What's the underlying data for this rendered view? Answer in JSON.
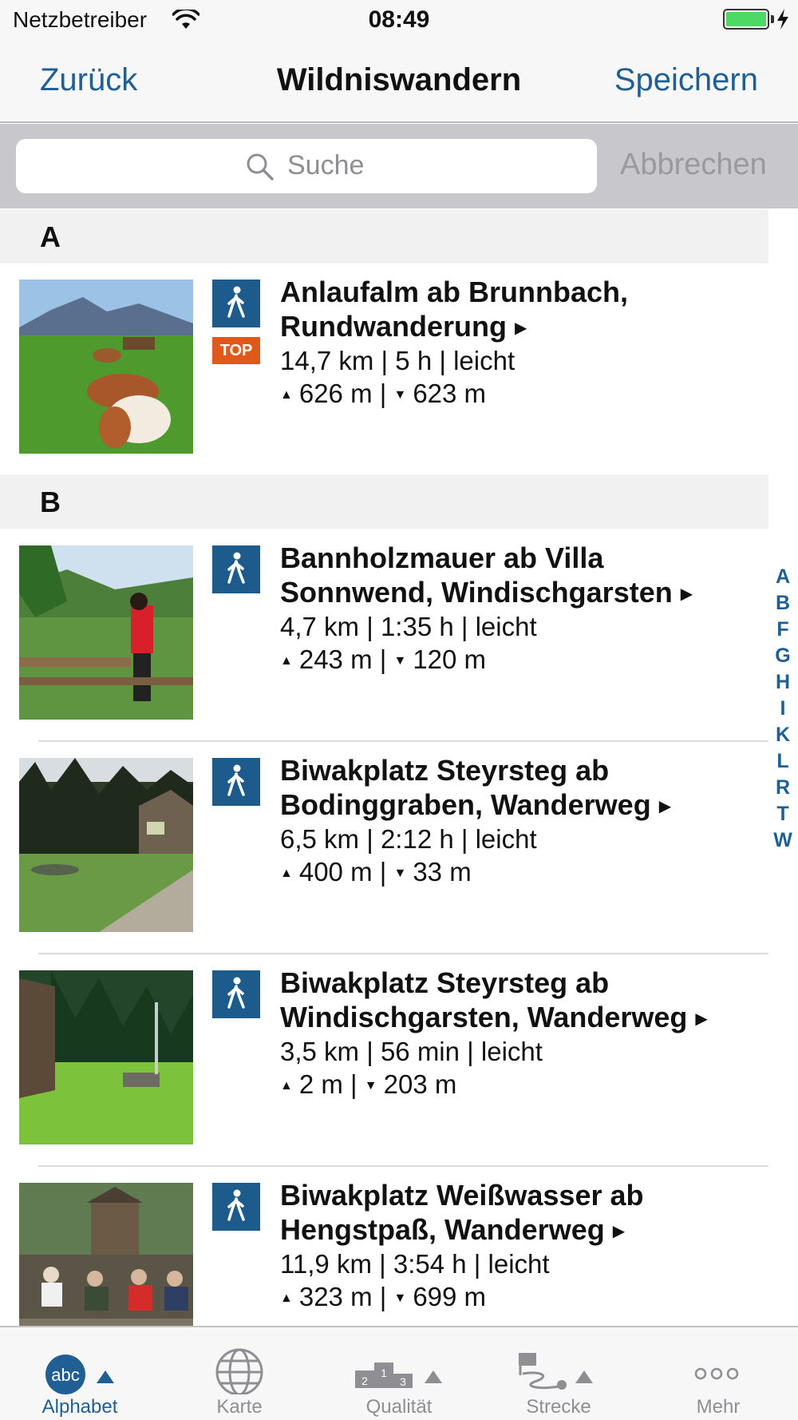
{
  "status_bar": {
    "carrier": "Netzbetreiber",
    "time": "08:49",
    "wifi_icon": "wifi-icon",
    "battery_icon": "battery-icon",
    "charging_icon": "bolt-icon"
  },
  "nav": {
    "back_label": "Zurück",
    "title": "Wildniswandern",
    "save_label": "Speichern"
  },
  "search": {
    "placeholder": "Suche",
    "cancel_label": "Abbrechen",
    "icon": "search-icon"
  },
  "sections": [
    {
      "letter": "A"
    },
    {
      "letter": "B"
    }
  ],
  "items": [
    {
      "title": "Anlaufalm ab Brunnbach, Rundwanderung",
      "stats": "14,7 km | 5 h | leicht",
      "up": "626 m",
      "down": "623 m",
      "badge": "TOP",
      "icon": "hiker-icon"
    },
    {
      "title": "Bannholzmauer ab Villa Sonnwend, Windischgarsten",
      "stats": "4,7 km | 1:35 h | leicht",
      "up": "243 m",
      "down": "120 m",
      "icon": "hiker-icon"
    },
    {
      "title": "Biwakplatz Steyrsteg ab Bodinggraben, Wanderweg",
      "stats": "6,5 km | 2:12 h | leicht",
      "up": "400 m",
      "down": "33 m",
      "icon": "hiker-icon"
    },
    {
      "title": "Biwakplatz Steyrsteg ab Windischgarsten, Wanderweg",
      "stats": "3,5 km | 56 min | leicht",
      "up": "2 m",
      "down": "203 m",
      "icon": "hiker-icon"
    },
    {
      "title": "Biwakplatz Weißwasser ab Hengstpaß, Wanderweg",
      "stats": "11,9 km | 3:54 h | leicht",
      "up": "323 m",
      "down": "699 m",
      "icon": "hiker-icon"
    }
  ],
  "index_letters": [
    "A",
    "B",
    "F",
    "G",
    "H",
    "I",
    "K",
    "L",
    "R",
    "T",
    "W"
  ],
  "tabs": [
    {
      "label": "Alphabet",
      "icon": "abc-sort-icon",
      "active": true
    },
    {
      "label": "Karte",
      "icon": "globe-icon",
      "active": false
    },
    {
      "label": "Qualität",
      "icon": "podium-icon",
      "active": false
    },
    {
      "label": "Strecke",
      "icon": "route-icon",
      "active": false
    },
    {
      "label": "Mehr",
      "icon": "more-dots-icon",
      "active": false
    }
  ],
  "colors": {
    "accent": "#1f5f93",
    "hike_icon_bg": "#1e5b8d",
    "top_badge": "#e0581a",
    "section_bg": "#f1f1f2",
    "search_bar_bg": "#c8c8cc"
  }
}
